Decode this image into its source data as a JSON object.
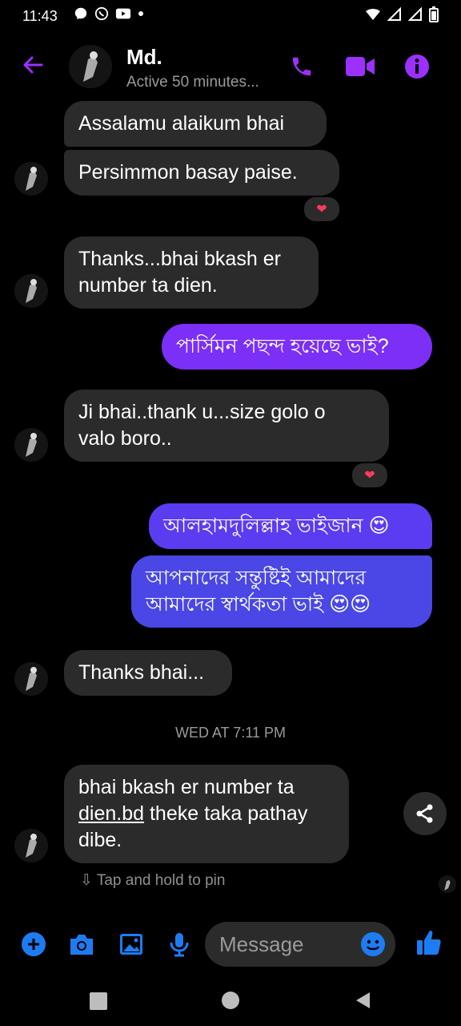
{
  "status_bar": {
    "time": "11:43",
    "left_icons": [
      "messenger-notification-icon",
      "whatsapp-icon",
      "youtube-icon",
      "dot-icon"
    ],
    "right_icons": [
      "wifi-icon",
      "signal-icon",
      "signal-icon",
      "battery-icon"
    ]
  },
  "header": {
    "name": "Md.",
    "status": "Active 50 minutes...",
    "accent": "#9b30ff",
    "icons": [
      "back-arrow-icon",
      "phone-icon",
      "video-camera-icon",
      "info-icon"
    ]
  },
  "messages": [
    {
      "dir": "in",
      "text": "Assalamu alaikum bhai"
    },
    {
      "dir": "in",
      "text": "Persimmon basay paise.",
      "reaction": "❤"
    },
    {
      "dir": "in",
      "line1": "Thanks...bhai bkash er",
      "line2": "number ta dien."
    },
    {
      "dir": "out",
      "text": "পার্সিমন পছন্দ হয়েছে ভাই?",
      "color": "#7b2ff7"
    },
    {
      "dir": "in",
      "line1": "Ji bhai..thank u...size golo o",
      "line2": "valo boro..",
      "reaction": "❤"
    },
    {
      "dir": "out",
      "text": "আলহামদুলিল্লাহ ভাইজান 😍",
      "color": "#5b3cf0"
    },
    {
      "dir": "out",
      "line1": "আপনাদের সন্তুষ্টিই আমাদের",
      "line2": "আমাদের স্বার্থকতা ভাই 😍😍",
      "color": "#4a47e6"
    },
    {
      "dir": "in",
      "text": "Thanks bhai..."
    },
    {
      "dir": "in",
      "line1": "bhai bkash er number ta",
      "line2_link": "dien.bd",
      "line2_rest": " theke taka pathay",
      "line3": "dibe."
    }
  ],
  "timestamp": "WED AT 7:11 PM",
  "pin_hint": "Tap and hold to pin",
  "composer": {
    "placeholder": "Message",
    "accent": "#1e7cf2",
    "icons": [
      "plus-icon",
      "camera-icon",
      "image-icon",
      "microphone-icon",
      "emoji-icon",
      "thumbs-up-icon"
    ]
  },
  "nav_bar": {
    "icons": [
      "recents-square-icon",
      "home-circle-icon",
      "back-triangle-icon"
    ]
  }
}
